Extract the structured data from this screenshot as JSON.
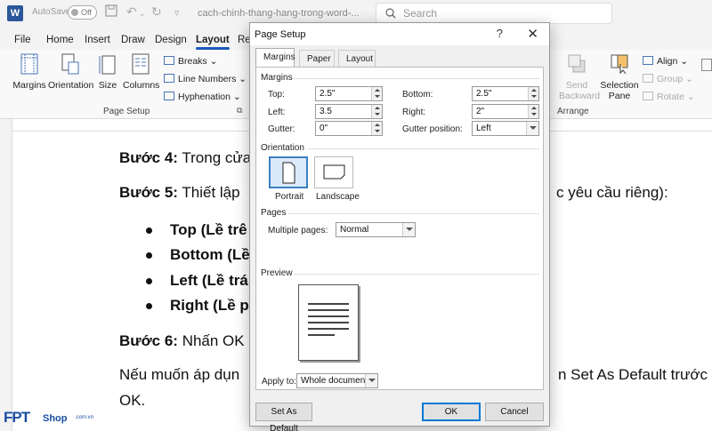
{
  "titlebar": {
    "autosave_label": "AutoSave",
    "autosave_state": "Off",
    "doc_name": "cach-chinh-thang-hang-trong-word-...",
    "search_placeholder": "Search"
  },
  "ribbon_tabs": [
    "File",
    "Home",
    "Insert",
    "Draw",
    "Design",
    "Layout",
    "Re"
  ],
  "ribbon_active_tab": "Layout",
  "ribbon": {
    "margins": "Margins",
    "orientation": "Orientation",
    "size": "Size",
    "columns": "Columns",
    "breaks": "Breaks",
    "line_numbers": "Line Numbers",
    "hyphenation": "Hyphenation",
    "page_setup_group": "Page Setup",
    "send_backward": "Send Backward",
    "selection_pane": "Selection Pane",
    "align": "Align",
    "group": "Group",
    "rotate": "Rotate",
    "arrange_group": "Arrange"
  },
  "document": {
    "step4_bold": "Bước 4:",
    "step4_text": " Trong cửa",
    "step5_bold": "Bước 5:",
    "step5_text": " Thiết lập",
    "step5_tail": "c yêu cầu riêng):",
    "bullets": [
      "Top (Lề trê",
      "Bottom (Lề",
      "Left (Lề trá",
      "Right (Lề p"
    ],
    "step6_bold": "Bước 6:",
    "step6_text": " Nhấn OK",
    "note_line1_start": "Nếu muốn áp dụn",
    "note_line1_end": "n Set As Default trước",
    "note_line2": "OK."
  },
  "dialog": {
    "title": "Page Setup",
    "help": "?",
    "close": "✕",
    "tabs": [
      "Margins",
      "Paper",
      "Layout"
    ],
    "active_tab": "Margins",
    "margins_section": "Margins",
    "top_label": "Top:",
    "top_value": "2.5\"",
    "bottom_label": "Bottom:",
    "bottom_value": "2.5\"",
    "left_label": "Left:",
    "left_value": "3.5",
    "right_label": "Right:",
    "right_value": "2\"",
    "gutter_label": "Gutter:",
    "gutter_value": "0\"",
    "gutter_position_label": "Gutter position:",
    "gutter_position_value": "Left",
    "orientation_section": "Orientation",
    "portrait": "Portrait",
    "landscape": "Landscape",
    "pages_section": "Pages",
    "multiple_pages_label": "Multiple pages:",
    "multiple_pages_value": "Normal",
    "preview_section": "Preview",
    "apply_to_label": "Apply to:",
    "apply_to_value": "Whole document",
    "set_default": "Set As Default",
    "ok": "OK",
    "cancel": "Cancel"
  },
  "watermark": {
    "brand": "FPT",
    "shop": "Shop",
    "domain": ".com.vn"
  }
}
